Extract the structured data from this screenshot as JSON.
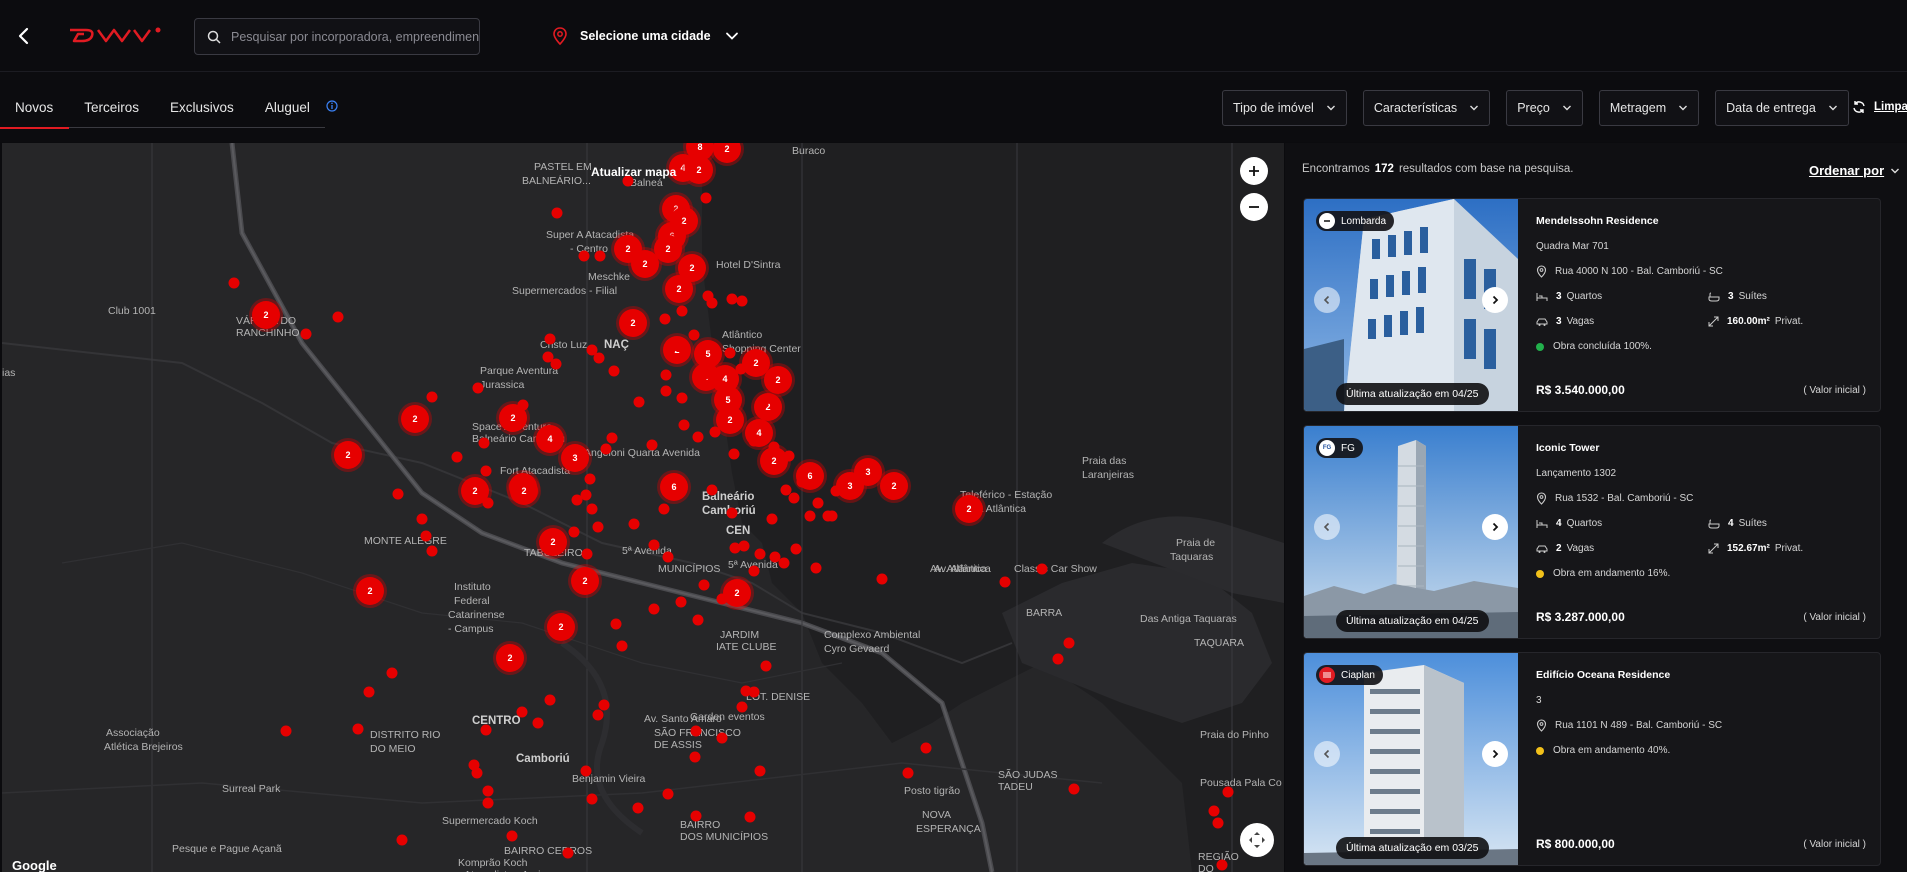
{
  "header": {
    "search_placeholder": "Pesquisar por incorporadora, empreendimento",
    "city_label": "Selecione uma cidade"
  },
  "tabs": [
    {
      "label": "Novos",
      "active": true
    },
    {
      "label": "Terceiros",
      "active": false
    },
    {
      "label": "Exclusivos",
      "active": false
    },
    {
      "label": "Aluguel",
      "active": false
    }
  ],
  "filters": [
    "Tipo de imóvel",
    "Características",
    "Preço",
    "Metragem",
    "Data de entrega"
  ],
  "clear_label": "Limpar",
  "map": {
    "update_label": "Atualizar mapa",
    "google_label": "Google",
    "labels": [
      {
        "text": "Buraco",
        "big": false
      },
      {
        "text": "PASTEL EM",
        "big": false
      },
      {
        "text": "BALNEÁRIO...",
        "big": false
      },
      {
        "text": "Balneá",
        "big": false
      },
      {
        "text": "Super A Atacadista",
        "big": false
      },
      {
        "text": "- Centro",
        "big": false
      },
      {
        "text": "Hotel D'Sintra",
        "big": false
      },
      {
        "text": "Meschke",
        "big": false
      },
      {
        "text": "Supermercados - Filial",
        "big": false
      },
      {
        "text": "Club 1001",
        "big": false
      },
      {
        "text": "VÁRZEA DO",
        "big": false
      },
      {
        "text": "RANCHINHO",
        "big": false
      },
      {
        "text": "Cristo Luz",
        "big": false
      },
      {
        "text": "NAÇ",
        "big": true
      },
      {
        "text": "Atlântico",
        "big": false
      },
      {
        "text": "Shopping Center",
        "big": false
      },
      {
        "text": "Parque Aventura",
        "big": false
      },
      {
        "text": "Jurassica",
        "big": false
      },
      {
        "text": "Space Adventure",
        "big": false
      },
      {
        "text": "Balneário Camboriú",
        "big": false
      },
      {
        "text": "Angeloni Quarta Avenida",
        "big": false
      },
      {
        "text": "Fort Atacadista",
        "big": false
      },
      {
        "text": "Praia das",
        "big": false
      },
      {
        "text": "Laranjeiras",
        "big": false
      },
      {
        "text": "Teleférico - Estação",
        "big": false
      },
      {
        "text": "Mata Atlântica",
        "big": false
      },
      {
        "text": "MONTE ALEGRE",
        "big": false
      },
      {
        "text": "CEN",
        "big": true
      },
      {
        "text": "Balneário",
        "big": true
      },
      {
        "text": "Camboriú",
        "big": true
      },
      {
        "text": "TABULEIRO",
        "big": false
      },
      {
        "text": "MUNICÍPIOS",
        "big": false
      },
      {
        "text": "5ª Avenida",
        "big": false
      },
      {
        "text": "5ª Avenida",
        "big": false
      },
      {
        "text": "Av. Atlântica",
        "big": false
      },
      {
        "text": "Classic Car Show",
        "big": false
      },
      {
        "text": "Praia de",
        "big": false
      },
      {
        "text": "Taquaras",
        "big": false
      },
      {
        "text": "BARRA",
        "big": false
      },
      {
        "text": "Das Antiga Taquaras",
        "big": false
      },
      {
        "text": "TAQUARA",
        "big": false
      },
      {
        "text": "Instituto",
        "big": false
      },
      {
        "text": "Federal",
        "big": false
      },
      {
        "text": "Catarinense",
        "big": false
      },
      {
        "text": "- Campus",
        "big": false
      },
      {
        "text": "JARDIM",
        "big": false
      },
      {
        "text": "IATE CLUBE",
        "big": false
      },
      {
        "text": "Complexo Ambiental",
        "big": false
      },
      {
        "text": "Cyro Gevaerd",
        "big": false
      },
      {
        "text": "LOT. DENISE",
        "big": false
      },
      {
        "text": "Associação",
        "big": false
      },
      {
        "text": "Atlética Brejeiros",
        "big": false
      },
      {
        "text": "DISTRITO RIO",
        "big": false
      },
      {
        "text": "DO MEIO",
        "big": false
      },
      {
        "text": "CENTRO",
        "big": true
      },
      {
        "text": "Av. Santo Amaro",
        "big": false
      },
      {
        "text": "SÃO FRANCISCO",
        "big": false
      },
      {
        "text": "DE ASSIS",
        "big": false
      },
      {
        "text": "Garden eventos",
        "big": false
      },
      {
        "text": "Camboriú",
        "big": true
      },
      {
        "text": "Surreal Park",
        "big": false
      },
      {
        "text": "Benjamin Vieira",
        "big": false
      },
      {
        "text": "Posto tigrão",
        "big": false
      },
      {
        "text": "SÃO JUDAS",
        "big": false
      },
      {
        "text": "TADEU",
        "big": false
      },
      {
        "text": "NOVA",
        "big": false
      },
      {
        "text": "ESPERANÇA",
        "big": false
      },
      {
        "text": "Praia do Pinho",
        "big": false
      },
      {
        "text": "Pousada Pala Co",
        "big": false
      },
      {
        "text": "Supermercado Koch",
        "big": false
      },
      {
        "text": "BAIRRO",
        "big": false
      },
      {
        "text": "DOS MUNICÍPIOS",
        "big": false
      },
      {
        "text": "Pesque e Pague Açanã",
        "big": false
      },
      {
        "text": "BAIRRO CEDROS",
        "big": false
      },
      {
        "text": "Komprão Koch",
        "big": false
      },
      {
        "text": "Atacadista - Areias",
        "big": false
      },
      {
        "text": "REGIÃO",
        "big": false
      },
      {
        "text": "DO",
        "big": false
      },
      {
        "text": "ias",
        "big": false
      },
      {
        "text": "Av. Atlântica",
        "big": false
      }
    ],
    "clusters": [
      {
        "count": "8"
      },
      {
        "count": "2"
      },
      {
        "count": "4"
      },
      {
        "count": "2"
      },
      {
        "count": "2"
      },
      {
        "count": "2"
      },
      {
        "count": "6"
      },
      {
        "count": "2"
      },
      {
        "count": "2"
      },
      {
        "count": "2"
      },
      {
        "count": "2"
      },
      {
        "count": "2"
      },
      {
        "count": "2"
      },
      {
        "count": "2"
      },
      {
        "count": "5"
      },
      {
        "count": "4"
      },
      {
        "count": "2"
      },
      {
        "count": "4"
      },
      {
        "count": "5"
      },
      {
        "count": "2"
      },
      {
        "count": "2"
      },
      {
        "count": "2"
      },
      {
        "count": "4"
      },
      {
        "count": "2"
      },
      {
        "count": "6"
      },
      {
        "count": "6"
      },
      {
        "count": "3"
      },
      {
        "count": "3"
      },
      {
        "count": "2"
      },
      {
        "count": "2"
      },
      {
        "count": "2"
      },
      {
        "count": "2"
      },
      {
        "count": "2"
      },
      {
        "count": "4"
      },
      {
        "count": "3"
      },
      {
        "count": "2"
      },
      {
        "count": "4"
      },
      {
        "count": "2"
      },
      {
        "count": "2"
      },
      {
        "count": "2"
      },
      {
        "count": "2"
      },
      {
        "count": "2"
      },
      {
        "count": "2"
      },
      {
        "count": "2"
      },
      {
        "count": "2"
      }
    ]
  },
  "results": {
    "found_prefix": "Encontramos",
    "found_count": "172",
    "found_suffix": "resultados com base na pesquisa.",
    "sort_label": "Ordenar por",
    "cards": [
      {
        "brand": "Lombarda",
        "name": "Mendelssohn Residence",
        "unit": "Quadra Mar 701",
        "address": "Rua 4000 N 100 - Bal. Camboriú - SC",
        "rooms_n": "3",
        "rooms_label": "Quartos",
        "suites_n": "3",
        "suites_label": "Suítes",
        "spots_n": "3",
        "spots_label": "Vagas",
        "area_n": "160.00m²",
        "area_label": "Privat.",
        "status": "Obra concluída 100%.",
        "status_color": "#22b14c",
        "updated": "Última atualização em 04/25",
        "price": "R$ 3.540.000,00",
        "price_note": "( Valor inicial )"
      },
      {
        "brand": "FG",
        "name": "Iconic Tower",
        "unit": "Lançamento 1302",
        "address": "Rua 1532 - Bal. Camboriú - SC",
        "rooms_n": "4",
        "rooms_label": "Quartos",
        "suites_n": "4",
        "suites_label": "Suítes",
        "spots_n": "2",
        "spots_label": "Vagas",
        "area_n": "152.67m²",
        "area_label": "Privat.",
        "status": "Obra em andamento 16%.",
        "status_color": "#f2c11a",
        "updated": "Última atualização em 04/25",
        "price": "R$ 3.287.000,00",
        "price_note": "( Valor inicial )"
      },
      {
        "brand": "Ciaplan",
        "name": "Edifício Oceana Residence",
        "unit": "3",
        "address": "Rua 1101 N 489 - Bal. Camboriú - SC",
        "status": "Obra em andamento 40%.",
        "status_color": "#f2c11a",
        "updated": "Última atualização em 03/25",
        "price": "R$ 800.000,00",
        "price_note": "( Valor inicial )"
      }
    ]
  },
  "colors": {
    "accent": "#e11b22",
    "marker": "#e60000"
  }
}
